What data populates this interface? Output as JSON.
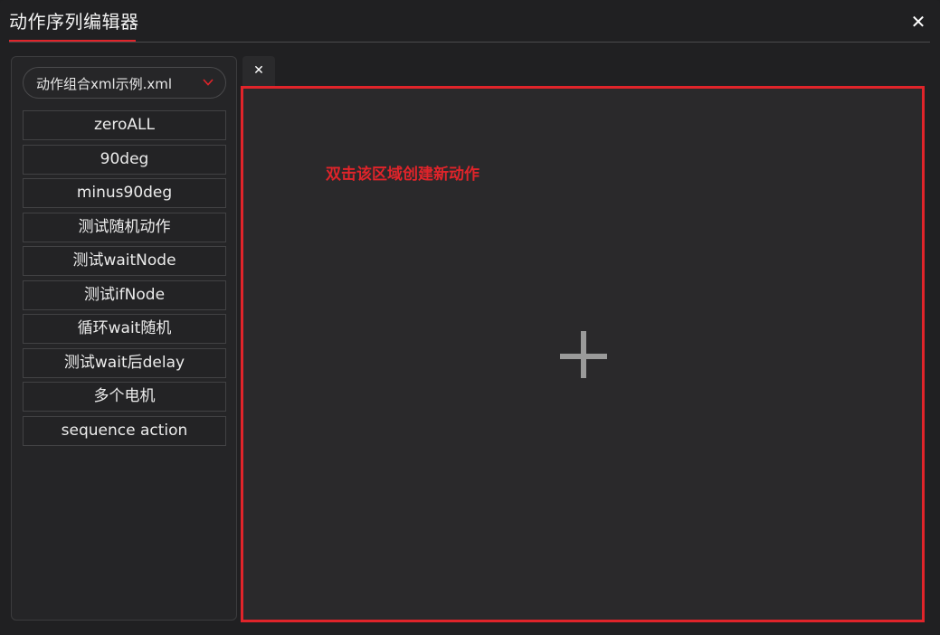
{
  "window": {
    "title": "动作序列编辑器",
    "close_symbol": "✕"
  },
  "sidebar": {
    "file_select": {
      "value": "动作组合xml示例.xml"
    },
    "items": [
      {
        "label": "zeroALL"
      },
      {
        "label": "90deg"
      },
      {
        "label": "minus90deg"
      },
      {
        "label": "测试随机动作"
      },
      {
        "label": "测试waitNode"
      },
      {
        "label": "测试ifNode"
      },
      {
        "label": "循环wait随机"
      },
      {
        "label": "测试wait后delay"
      },
      {
        "label": "多个电机"
      },
      {
        "label": "sequence action"
      }
    ]
  },
  "editor": {
    "tab_close_symbol": "✕",
    "hint": "双击该区域创建新动作"
  },
  "colors": {
    "accent": "#e0242a",
    "background": "#202022",
    "canvas": "#2a292b",
    "plus": "#9a9a9a"
  },
  "icons": {
    "close": "close-icon",
    "chevron": "chevron-down-icon",
    "plus": "plus-icon"
  }
}
